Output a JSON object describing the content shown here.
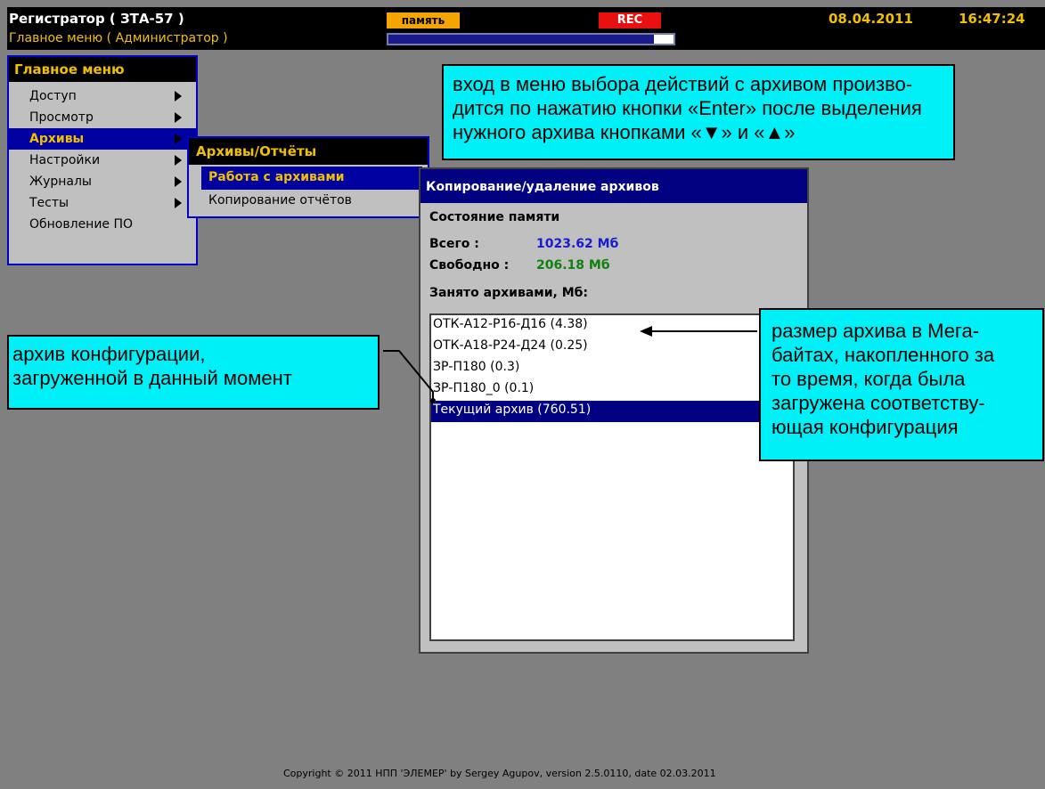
{
  "topbar": {
    "title": "Регистратор ( ЗТА-57 )",
    "subtitle": "Главное меню ( Администратор )",
    "memory_badge": "память",
    "rec_badge": "REC",
    "memory_usage_fraction": 0.93,
    "date": "08.04.2011",
    "time": "16:47:24"
  },
  "main_menu": {
    "title": "Главное меню",
    "items": [
      {
        "label": "Доступ"
      },
      {
        "label": "Просмотр"
      },
      {
        "label": "Архивы"
      },
      {
        "label": "Настройки"
      },
      {
        "label": "Журналы"
      },
      {
        "label": "Тесты"
      },
      {
        "label": "Обновление ПО"
      }
    ]
  },
  "sub_menu": {
    "title": "Архивы/Отчёты",
    "items": [
      {
        "label": "Работа с архивами"
      },
      {
        "label": "Копирование отчётов"
      }
    ]
  },
  "dialog": {
    "title": "Копирование/удаление архивов",
    "memory_header": "Состояние памяти",
    "total_label": "Всего :",
    "total_value": "1023.62 Мб",
    "free_label": "Свободно :",
    "free_value": "206.18 Мб",
    "occupied_label": "Занято архивами, Мб:",
    "archives": [
      "ОТК-А12-Р16-Д16 (4.38)",
      "ОТК-А18-Р24-Д24 (0.25)",
      "ЗР-П180 (0.3)",
      "ЗР-П180_0 (0.1)",
      "Текущий архив (760.51)"
    ]
  },
  "callouts": {
    "enter_line1": "вход в меню выбора действий с архивом произво-",
    "enter_line2": "дится по нажатию кнопки «Enter» после выделения",
    "enter_line3": "нужного архива кнопками «▼» и «▲»",
    "config_line1": "архив конфигурации,",
    "config_line2": "загруженной в данный момент",
    "size_line1": "размер архива в Мега-",
    "size_line2": "байтах, накопленного за",
    "size_line3": "то время, когда была",
    "size_line4": "загружена соответству-",
    "size_line5": "ющая конфигурация"
  },
  "footer": {
    "copyright": "Copyright © 2011 НПП 'ЭЛЕМЕР' by Sergey Agupov, version 2.5.0110, date 02.03.2011"
  }
}
